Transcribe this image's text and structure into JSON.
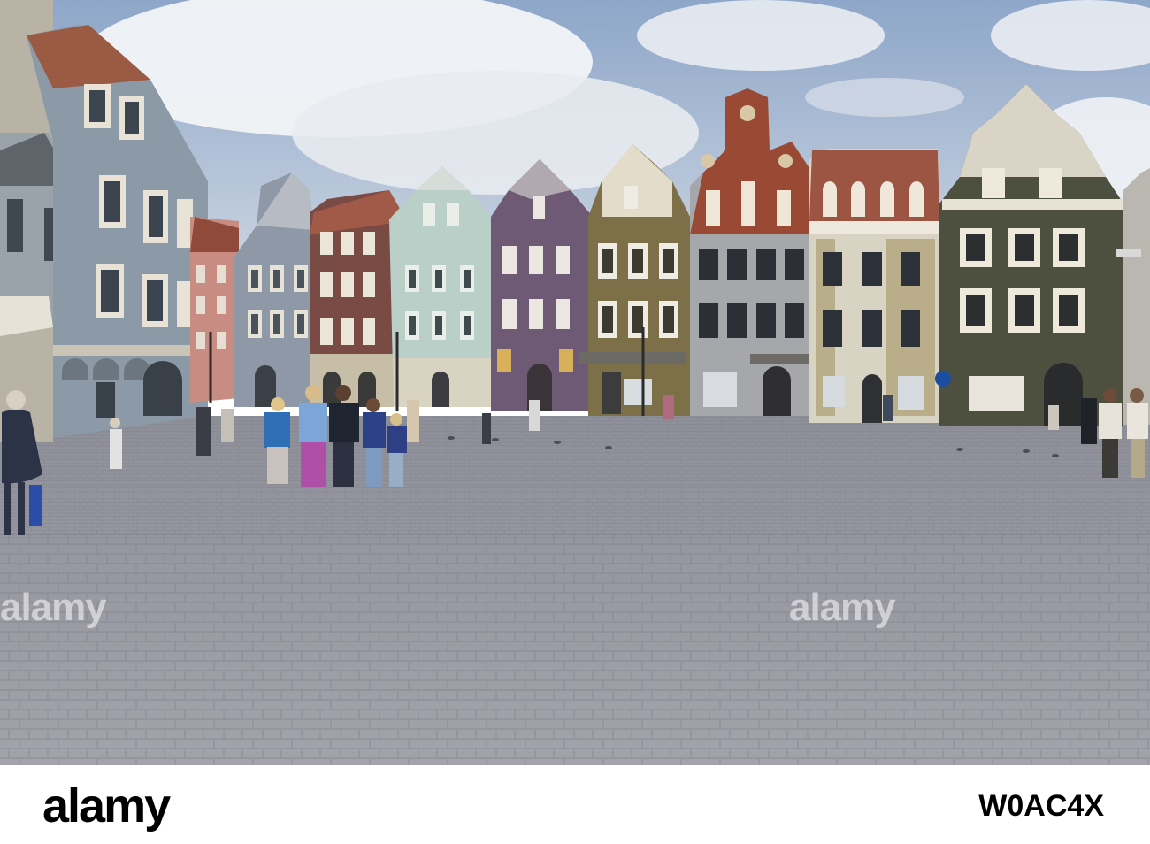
{
  "watermark": {
    "brand_left": "alamy",
    "brand_right": "alamy",
    "footer_brand": "alamy",
    "image_code": "W0AC4X"
  },
  "palette": {
    "sky": "#9fb4d2",
    "cobbles": "#9c9da6",
    "gray_blue_house": "#8b9aa6",
    "purple_house": "#6e5a74",
    "olive_house": "#7d7048",
    "brick_house": "#9a4a34",
    "dark_green_house": "#4d4f3f"
  }
}
